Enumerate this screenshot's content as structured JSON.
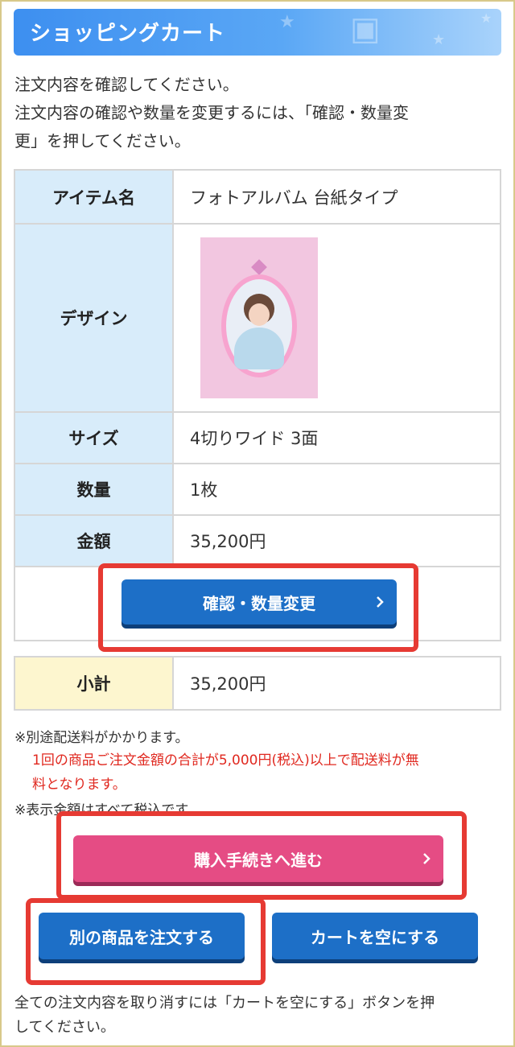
{
  "header": {
    "title": "ショッピングカート"
  },
  "intro": {
    "line1": "注文内容を確認してください。",
    "line2": "注文内容の確認や数量を変更するには、「確認・数量変",
    "line3": "更」を押してください。"
  },
  "cart": {
    "rows": [
      {
        "label": "アイテム名",
        "value": "フォトアルバム 台紙タイプ"
      },
      {
        "label": "デザイン",
        "value": ""
      },
      {
        "label": "サイズ",
        "value": "4切りワイド 3面"
      },
      {
        "label": "数量",
        "value": "1枚"
      },
      {
        "label": "金額",
        "value": "35,200円"
      }
    ],
    "confirm_button": "確認・数量変更"
  },
  "subtotal": {
    "label": "小計",
    "value": "35,200円"
  },
  "notes": {
    "shipping": "※別途配送料がかかります。",
    "free_shipping_line1": "1回の商品ご注文金額の合計が5,000円(税込)以上で配送料が無",
    "free_shipping_line2": "料となります。",
    "tax": "※表示金額はすべて税込です。"
  },
  "buttons": {
    "checkout": "購入手続きへ進む",
    "other_product": "別の商品を注文する",
    "empty_cart": "カートを空にする"
  },
  "footer": {
    "line1": "全ての注文内容を取り消すには「カートを空にする」ボタンを押",
    "line2": "してください。"
  },
  "colors": {
    "header_blue": "#3d8ff0",
    "button_blue": "#1d6fc7",
    "button_pink": "#e54c84",
    "highlight_red": "#e63a33",
    "note_red": "#e0281f"
  },
  "icons": [
    "chevron-right-icon",
    "camera-icon",
    "star-icon"
  ]
}
